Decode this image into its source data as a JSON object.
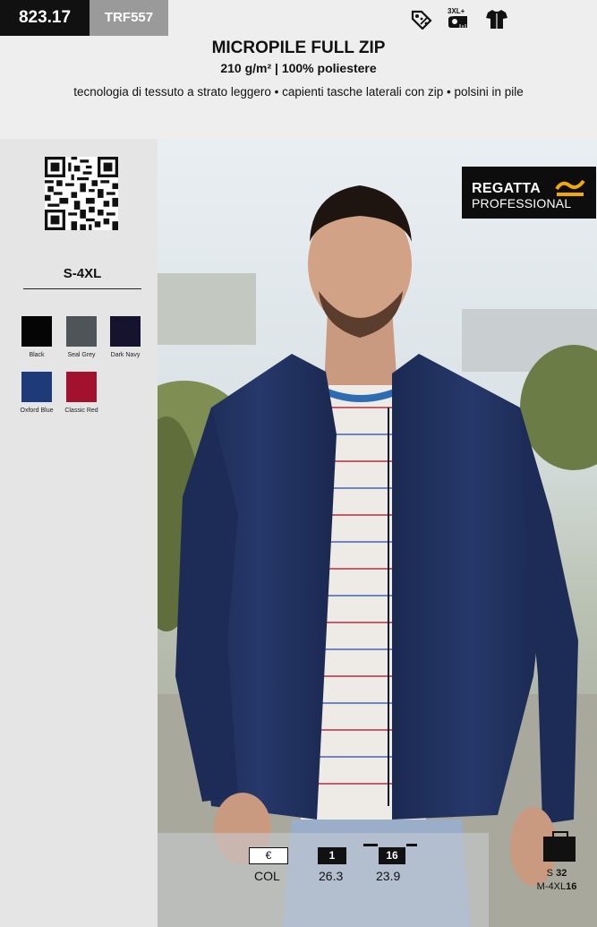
{
  "header_codes": {
    "main": "823.17",
    "alt": "TRF557"
  },
  "icons": [
    "discount-tag-icon",
    "size-range-3xl-plus-icon",
    "tshirt-icon"
  ],
  "icon_text": {
    "size_range": "3XL+"
  },
  "product": {
    "title": "MICROPILE  FULL ZIP",
    "subtitle": "210 g/m² | 100% poliestere",
    "features": "tecnologia di tessuto a strato leggero • capienti tasche laterali con zip • polsini in pile"
  },
  "sizes": "S-4XL",
  "colors": [
    {
      "name": "Black",
      "hex": "#050505"
    },
    {
      "name": "Seal Grey",
      "hex": "#4f5458"
    },
    {
      "name": "Dark Navy",
      "hex": "#15132d"
    },
    {
      "name": "Oxford Blue",
      "hex": "#1f3a78"
    },
    {
      "name": "Classic Red",
      "hex": "#a2122f"
    }
  ],
  "brand": {
    "line1": "REGATTA",
    "line2": "PROFESSIONAL",
    "accent": "#f2a900"
  },
  "pricing": {
    "currency_label": "€",
    "col_label": "COL",
    "qty1_label": "1",
    "qty1_price": "26.3",
    "qty16_label": "16",
    "qty16_price": "23.9"
  },
  "packaging": {
    "s_label": "S",
    "s_value": "32",
    "m_label": "M-4XL",
    "m_value": "16"
  }
}
